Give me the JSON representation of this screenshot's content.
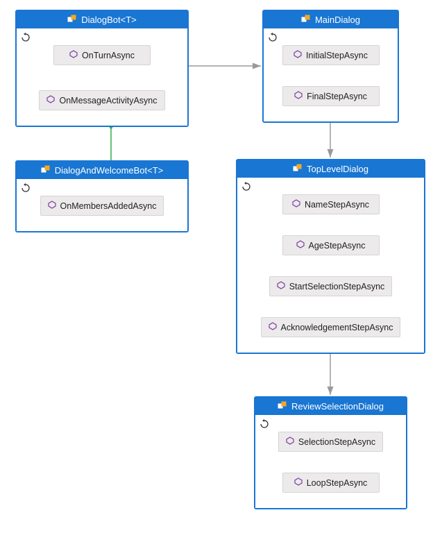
{
  "nodes": {
    "dialogBot": {
      "title": "DialogBot<T>",
      "methods": [
        "OnTurnAsync",
        "OnMessageActivityAsync"
      ]
    },
    "dialogAndWelcomeBot": {
      "title": "DialogAndWelcomeBot<T>",
      "methods": [
        "OnMembersAddedAsync"
      ]
    },
    "mainDialog": {
      "title": "MainDialog",
      "methods": [
        "InitialStepAsync",
        "FinalStepAsync"
      ]
    },
    "topLevelDialog": {
      "title": "TopLevelDialog",
      "methods": [
        "NameStepAsync",
        "AgeStepAsync",
        "StartSelectionStepAsync",
        "AcknowledgementStepAsync"
      ]
    },
    "reviewSelectionDialog": {
      "title": "ReviewSelectionDialog",
      "methods": [
        "SelectionStepAsync",
        "LoopStepAsync"
      ]
    }
  }
}
